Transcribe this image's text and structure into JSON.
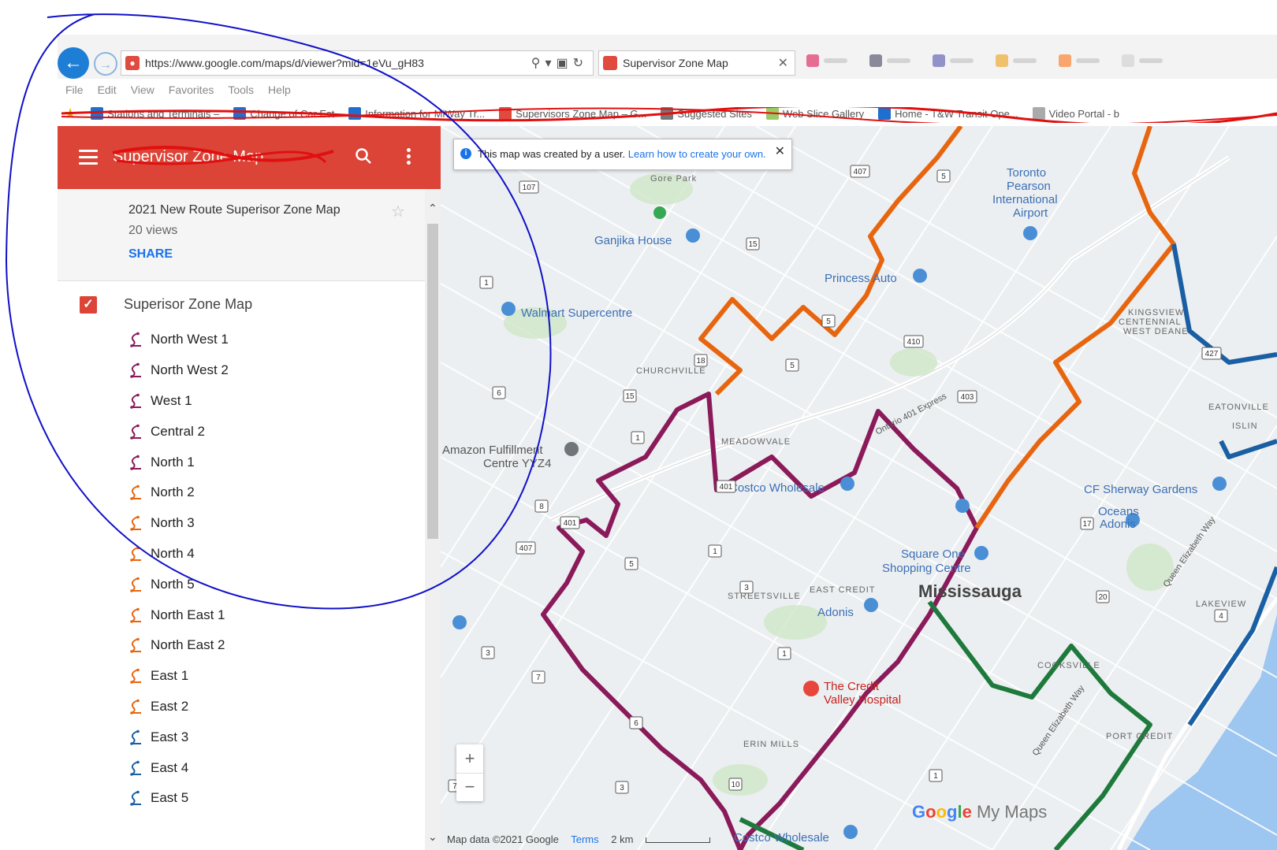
{
  "browser": {
    "address_url": "https://www.google.com/maps/d/viewer?mid=1eVu_gH83",
    "tab_title": "Supervisor Zone Map",
    "menu": [
      "File",
      "Edit",
      "View",
      "Favorites",
      "Tools",
      "Help"
    ],
    "favorites": [
      "Stations and Terminals –",
      "Change of Car Est",
      "Information for MiWay Tr...",
      "Supervisors Zone Map – G...",
      "Suggested Sites",
      "Web Slice Gallery",
      "Home - T&W Transit Ope...",
      "Video Portal - b"
    ]
  },
  "header": {
    "title": "Supervisor Zone Map"
  },
  "info": {
    "map_name": "2021 New Route Superisor Zone Map",
    "views": "20 views",
    "share": "SHARE"
  },
  "layer": {
    "name": "Superisor Zone Map"
  },
  "routes": [
    {
      "label": "North West 1",
      "color": "#8b1a5a"
    },
    {
      "label": "North West 2",
      "color": "#8b1a5a"
    },
    {
      "label": "West 1",
      "color": "#8b1a5a"
    },
    {
      "label": "Central 2",
      "color": "#8b1a5a"
    },
    {
      "label": "North 1",
      "color": "#8b1a5a"
    },
    {
      "label": "North 2",
      "color": "#e8650f"
    },
    {
      "label": "North 3",
      "color": "#e8650f"
    },
    {
      "label": "North 4",
      "color": "#e8650f"
    },
    {
      "label": "North 5",
      "color": "#e8650f"
    },
    {
      "label": "North East 1",
      "color": "#e8650f"
    },
    {
      "label": "North East 2",
      "color": "#e8650f"
    },
    {
      "label": "East 1",
      "color": "#e8650f"
    },
    {
      "label": "East 2",
      "color": "#e8650f"
    },
    {
      "label": "East 3",
      "color": "#1a5fa3"
    },
    {
      "label": "East 4",
      "color": "#1a5fa3"
    },
    {
      "label": "East 5",
      "color": "#1a5fa3"
    }
  ],
  "map": {
    "banner_text": "This map was created by a user.",
    "banner_link": "Learn how to create your own.",
    "attribution": "Map data ©2021 Google",
    "terms": "Terms",
    "scale": "2 km",
    "logo_google": "Google",
    "logo_mymaps": "My Maps",
    "labels": {
      "ganjika": "Ganjika House",
      "princess": "Princess Auto",
      "walmart": "Walmart Supercentre",
      "churchville": "CHURCHVILLE",
      "meadowvale": "MEADOWVALE",
      "amazon1": "Amazon Fulfillment",
      "amazon2": "Centre YYZ4",
      "costco1": "Costco Wholesale",
      "oceans": "Oceans",
      "cf": "CF Sherway Gardens",
      "adonis1": "Adonis",
      "square1": "Square One",
      "square2": "Shopping Centre",
      "mississauga": "Mississauga",
      "eastcredit": "EAST CREDIT",
      "streetsville": "STREETSVILLE",
      "adonis2": "Adonis",
      "credit1": "The Credit",
      "credit2": "Valley Hospital",
      "erin": "ERIN MILLS",
      "costco2": "Costco Wholesale",
      "airport1": "Toronto",
      "airport2": "Pearson",
      "airport3": "International",
      "airport4": "Airport",
      "kingsview1": "KINGSVIEW",
      "centennial": "CENTENNIAL",
      "westdeane": "WEST DEANE",
      "eatonville": "EATONVILLE",
      "islington": "ISLIN",
      "lakeview": "LAKEVIEW",
      "cooksville": "COOKSVILLE",
      "portcredit": "PORT CREDIT",
      "ont401": "Ontario 401 Express",
      "qew1": "Queen Elizabeth Way",
      "qew2": "Queen Elizabeth Way",
      "gorepark": "Gore Park"
    },
    "shields": [
      "407",
      "5",
      "107",
      "15",
      "410",
      "5",
      "1",
      "18",
      "5",
      "15",
      "403",
      "6",
      "1",
      "401",
      "8",
      "401",
      "407",
      "5",
      "1",
      "3",
      "17",
      "427",
      "20",
      "4",
      "3",
      "7",
      "1",
      "6",
      "3",
      "1",
      "7",
      "10"
    ]
  },
  "colors": {
    "header": "#db4437",
    "purple_zone": "#8b1a5a",
    "orange_zone": "#e8650f",
    "blue_zone": "#1a5fa3",
    "green_zone": "#1e7a3c",
    "link": "#1a73e8"
  }
}
